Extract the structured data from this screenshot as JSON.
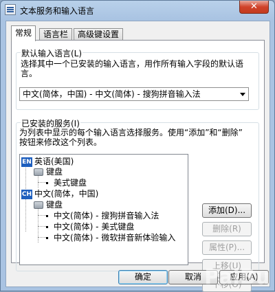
{
  "window": {
    "title": "文本服务和输入语言",
    "close_glyph": "✕"
  },
  "tabs": [
    "常规",
    "语言栏",
    "高级键设置"
  ],
  "default_group": {
    "title": "默认输入语言(L)",
    "description": "选择其中一个已安装的输入语言，用作所有输入字段的默认语言。",
    "selected": "中文(简体，中国) - 中文(简体) - 搜狗拼音输入法"
  },
  "installed_group": {
    "title": "已安装的服务(I)",
    "description_line1": "为列表中显示的每个输入语言选择服务。使用“添加”和“删除”",
    "description_line2": "按钮来修改这个列表。",
    "tree": {
      "lang1": {
        "badge": "EN",
        "label": "英语(美国)"
      },
      "lang1_keyboard": "键盘",
      "lang1_items": [
        "美式键盘"
      ],
      "lang2": {
        "badge": "CH",
        "label": "中文(简体，中国)"
      },
      "lang2_keyboard": "键盘",
      "lang2_items": [
        "中文(简体) - 搜狗拼音输入法",
        "中文(简体) - 美式键盘",
        "中文(简体) - 微软拼音新体验输入"
      ]
    },
    "buttons": {
      "add": "添加(D)...",
      "remove": "删除(R)",
      "properties": "属性(P)...",
      "move_up": "上移(U)",
      "move_down": "下移(O)"
    }
  },
  "footer": {
    "ok": "确定",
    "cancel": "取消",
    "apply": "应用(A)"
  },
  "watermark": "PaiBu"
}
